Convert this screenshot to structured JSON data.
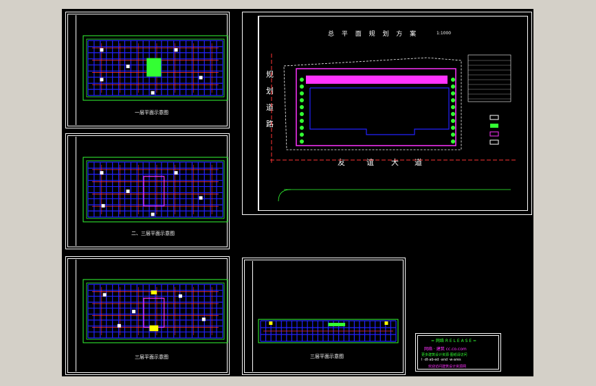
{
  "sheets": {
    "plan1_caption": "一层平面示意图",
    "plan2_caption": "二、三层平面示意图",
    "plan3_caption": "三层平面示意图",
    "plan4_caption": "三层平面示意图"
  },
  "site": {
    "title": "总 平 面 规 划 方 案",
    "scale": "1:1000",
    "road_left": [
      "规",
      "划",
      "道",
      "路"
    ],
    "road_bottom": [
      "友",
      "谊",
      "大",
      "道"
    ]
  },
  "titleblock": {
    "line1": "= 网络  R E L E A S E =",
    "line2": "网络 · 建筑  cc.co.com",
    "line3": "更多建筑设计资源·图纸请访问",
    "line4": "I ·dt·ab·ed ·and ·w·ares",
    "line5": "欢迎访问建筑设计资源网"
  },
  "colors": {
    "background": "#000000",
    "frame": "#ffffff",
    "grid_blue": "#2222ff",
    "grid_red": "#ff3333",
    "wall_green": "#33ff33",
    "magenta": "#ff33ff",
    "yellow": "#ffff00"
  }
}
